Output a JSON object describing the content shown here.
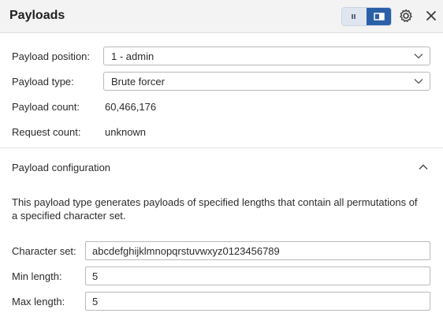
{
  "header": {
    "title": "Payloads",
    "icons": [
      "list-view-icon",
      "split-view-icon",
      "gear-icon",
      "close-icon"
    ]
  },
  "fields": {
    "position_label": "Payload position:",
    "position_value": "1 - admin",
    "type_label": "Payload type:",
    "type_value": "Brute forcer",
    "count_label": "Payload count:",
    "count_value": "60,466,176",
    "request_label": "Request count:",
    "request_value": "unknown"
  },
  "config": {
    "title": "Payload configuration",
    "description": "This payload type generates payloads of specified lengths that contain all permutations of a specified character set.",
    "charset_label": "Character set:",
    "charset_value": "abcdefghijklmnopqrstuvwxyz0123456789",
    "min_label": "Min length:",
    "min_value": "5",
    "max_label": "Max length:",
    "max_value": "5"
  },
  "colors": {
    "accent": "#2a5fa8",
    "header_bg": "#f3f3f3"
  }
}
